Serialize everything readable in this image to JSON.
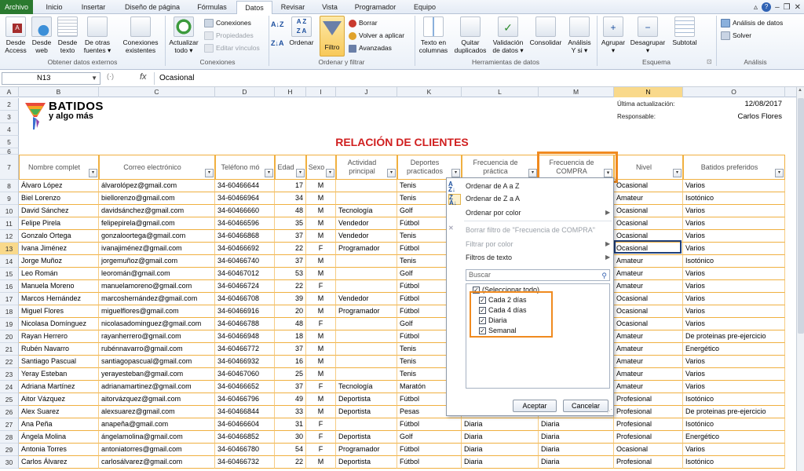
{
  "tabs": [
    "Archivo",
    "Inicio",
    "Insertar",
    "Diseño de página",
    "Fórmulas",
    "Datos",
    "Revisar",
    "Vista",
    "Programador",
    "Equipo"
  ],
  "active_tab": "Datos",
  "ribbon": {
    "ext_btns": [
      {
        "l1": "Desde",
        "l2": "Access"
      },
      {
        "l1": "Desde",
        "l2": "web"
      },
      {
        "l1": "Desde",
        "l2": "texto"
      },
      {
        "l1": "De otras",
        "l2": "fuentes ▾"
      },
      {
        "l1": "Conexiones",
        "l2": "existentes"
      }
    ],
    "g_ext": "Obtener datos externos",
    "refresh": {
      "l1": "Actualizar",
      "l2": "todo ▾"
    },
    "conn_small": [
      "Conexiones",
      "Propiedades",
      "Editar vínculos"
    ],
    "g_conn": "Conexiones",
    "sort_btn": "Ordenar",
    "filter_btn": "Filtro",
    "filter_small": [
      "Borrar",
      "Volver a aplicar",
      "Avanzadas"
    ],
    "g_sort": "Ordenar y filtrar",
    "tools": [
      {
        "l1": "Texto en",
        "l2": "columnas"
      },
      {
        "l1": "Quitar",
        "l2": "duplicados"
      },
      {
        "l1": "Validación",
        "l2": "de datos ▾"
      },
      {
        "l1": "Consolidar",
        "l2": ""
      },
      {
        "l1": "Análisis",
        "l2": "Y si ▾"
      }
    ],
    "g_tools": "Herramientas de datos",
    "outline": [
      {
        "l1": "Agrupar",
        "l2": "▾"
      },
      {
        "l1": "Desagrupar",
        "l2": "▾"
      },
      {
        "l1": "Subtotal",
        "l2": ""
      }
    ],
    "g_outline": "Esquema",
    "analysis": [
      "Análisis de datos",
      "Solver"
    ],
    "g_analysis": "Análisis"
  },
  "namebox": "N13",
  "formula": "Ocasional",
  "cols": [
    "A",
    "B",
    "C",
    "D",
    "H",
    "I",
    "J",
    "K",
    "L",
    "M",
    "N",
    "O"
  ],
  "rows": [
    "2",
    "3",
    "4",
    "5",
    "6",
    "7",
    "8",
    "9",
    "10",
    "11",
    "12",
    "13",
    "14",
    "15",
    "16",
    "17",
    "18",
    "19",
    "20",
    "21",
    "22",
    "23",
    "24",
    "25",
    "26",
    "27",
    "28",
    "29",
    "30"
  ],
  "logo": {
    "l1": "BATIDOS",
    "l2": "y algo más"
  },
  "info": {
    "upd_label": "Última actualización:",
    "upd_value": "12/08/2017",
    "resp_label": "Responsable:",
    "resp_value": "Carlos Flores"
  },
  "title": "RELACIÓN DE CLIENTES",
  "headers": [
    "Nombre complet",
    "Correo electrónico",
    "Teléfono mó",
    "Edad",
    "Sexo",
    "Actividad principal",
    "Deportes practicados",
    "Frecuencia de práctica",
    "Frecuencia de COMPRA",
    "Nivel",
    "Batidos preferidos"
  ],
  "table": [
    [
      "Álvaro López",
      "álvarolópez@gmail.com",
      "34-60466644",
      "17",
      "M",
      "",
      "Tenis",
      "",
      "",
      "Ocasional",
      "Varios"
    ],
    [
      "Biel Lorenzo",
      "biellorenzo@gmail.com",
      "34-60466964",
      "34",
      "M",
      "",
      "Tenis",
      "",
      "",
      "Amateur",
      "Isotónico"
    ],
    [
      "David Sánchez",
      "davidsánchez@gmail.com",
      "34-60466660",
      "48",
      "M",
      "Tecnología",
      "Golf",
      "",
      "",
      "Ocasional",
      "Varios"
    ],
    [
      "Felipe Pirela",
      "felipepirela@gmail.com",
      "34-60466596",
      "35",
      "M",
      "Vendedor",
      "Fútbol",
      "",
      "",
      "Ocasional",
      "Varios"
    ],
    [
      "Gonzalo Ortega",
      "gonzaloortega@gmail.com",
      "34-60466868",
      "37",
      "M",
      "Vendedor",
      "Tenis",
      "",
      "",
      "Ocasional",
      "Varios"
    ],
    [
      "Ivana Jiménez",
      "ivanajiménez@gmail.com",
      "34-60466692",
      "22",
      "F",
      "Programador",
      "Fútbol",
      "",
      "",
      "Ocasional",
      "Varios"
    ],
    [
      "Jorge Muñoz",
      "jorgemuñoz@gmail.com",
      "34-60466740",
      "37",
      "M",
      "",
      "Tenis",
      "",
      "",
      "Amateur",
      "Isotónico"
    ],
    [
      "Leo Román",
      "leoromán@gmail.com",
      "34-60467012",
      "53",
      "M",
      "",
      "Golf",
      "",
      "",
      "Amateur",
      "Varios"
    ],
    [
      "Manuela Moreno",
      "manuelamoreno@gmail.com",
      "34-60466724",
      "22",
      "F",
      "",
      "Fútbol",
      "",
      "",
      "Amateur",
      "Varios"
    ],
    [
      "Marcos Hernández",
      "marcoshernández@gmail.com",
      "34-60466708",
      "39",
      "M",
      "Vendedor",
      "Fútbol",
      "",
      "",
      "Ocasional",
      "Varios"
    ],
    [
      "Miguel Flores",
      "miguelflores@gmail.com",
      "34-60466916",
      "20",
      "M",
      "Programador",
      "Fútbol",
      "",
      "",
      "Ocasional",
      "Varios"
    ],
    [
      "Nicolasa Domínguez",
      "nicolasadominguez@gmail.com",
      "34-60466788",
      "48",
      "F",
      "",
      "Golf",
      "",
      "",
      "Ocasional",
      "Varios"
    ],
    [
      "Rayan Herrero",
      "rayanherrero@gmail.com",
      "34-60466948",
      "18",
      "M",
      "",
      "Fútbol",
      "",
      "",
      "Amateur",
      "De proteinas pre-ejercicio"
    ],
    [
      "Rubén Navarro",
      "rubénnavarro@gmail.com",
      "34-60466772",
      "37",
      "M",
      "",
      "Tenis",
      "",
      "",
      "Amateur",
      "Energético"
    ],
    [
      "Santiago Pascual",
      "santiagopascual@gmail.com",
      "34-60466932",
      "16",
      "M",
      "",
      "Tenis",
      "",
      "",
      "Amateur",
      "Varios"
    ],
    [
      "Yeray Esteban",
      "yerayesteban@gmail.com",
      "34-60467060",
      "25",
      "M",
      "",
      "Tenis",
      "",
      "",
      "Amateur",
      "Varios"
    ],
    [
      "Adriana Martínez",
      "adrianamartinez@gmail.com",
      "34-60466652",
      "37",
      "F",
      "Tecnología",
      "Maratón",
      "",
      "",
      "Amateur",
      "Varios"
    ],
    [
      "Aitor Vázquez",
      "aitorvázquez@gmail.com",
      "34-60466796",
      "49",
      "M",
      "Deportista",
      "Fútbol",
      "",
      "",
      "Profesional",
      "Isotónico"
    ],
    [
      "Alex Suarez",
      "alexsuarez@gmail.com",
      "34-60466844",
      "33",
      "M",
      "Deportista",
      "Pesas",
      "",
      "",
      "Profesional",
      "De proteinas pre-ejercicio"
    ],
    [
      "Ana Peña",
      "anapeña@gmail.com",
      "34-60466604",
      "31",
      "F",
      "",
      "Fútbol",
      "Diaria",
      "Diaria",
      "Profesional",
      "Isotónico"
    ],
    [
      "Ángela Molina",
      "ángelamolina@gmail.com",
      "34-60466852",
      "30",
      "F",
      "Deportista",
      "Golf",
      "Diaria",
      "Diaria",
      "Profesional",
      "Energético"
    ],
    [
      "Antonia Torres",
      "antoniatorres@gmail.com",
      "34-60466780",
      "54",
      "F",
      "Programador",
      "Fútbol",
      "Diaria",
      "Diaria",
      "Ocasional",
      "Varios"
    ],
    [
      "Carlos Álvarez",
      "carlosálvarez@gmail.com",
      "34-60466732",
      "22",
      "M",
      "Deportista",
      "Fútbol",
      "Diaria",
      "Diaria",
      "Profesional",
      "Isotónico"
    ]
  ],
  "dropdown": {
    "sort_az": "Ordenar de A a Z",
    "sort_za": "Ordenar de Z a A",
    "sort_color": "Ordenar por color",
    "clear": "Borrar filtro de \"Frecuencia de COMPRA\"",
    "filter_color": "Filtrar por color",
    "text_filters": "Filtros de texto",
    "search": "Buscar",
    "items": [
      {
        "label": "(Seleccionar todo)",
        "checked": true
      },
      {
        "label": "Cada 2 días",
        "checked": true
      },
      {
        "label": "Cada 4 días",
        "checked": true
      },
      {
        "label": "Diaria",
        "checked": true
      },
      {
        "label": "Semanal",
        "checked": true
      }
    ],
    "ok": "Aceptar",
    "cancel": "Cancelar"
  },
  "colors": {
    "accent_orange": "#f08a1f",
    "title_red": "#d01f1f",
    "file_tab": "#2b7a2f"
  }
}
